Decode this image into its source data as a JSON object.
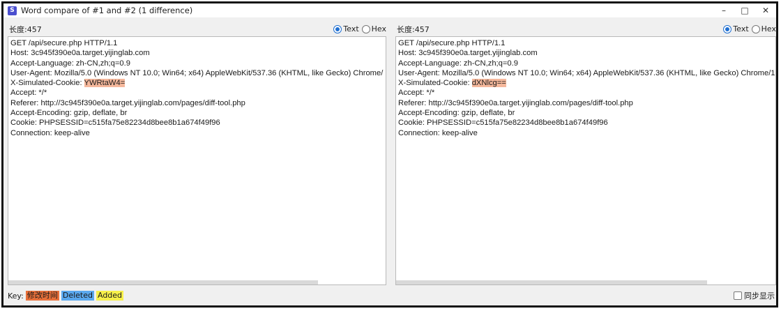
{
  "window": {
    "title": "Word compare of #1 and #2  (1 difference)",
    "icon_text": "S",
    "controls": {
      "minimize": "–",
      "maximize": "□",
      "close": "✕"
    }
  },
  "left_pane": {
    "length_label": "长度:457",
    "radio_text": "Text",
    "radio_hex": "Hex",
    "lines": [
      "GET /api/secure.php HTTP/1.1",
      "Host: 3c945f390e0a.target.yijinglab.com",
      "Accept-Language: zh-CN,zh;q=0.9",
      "User-Agent: Mozilla/5.0 (Windows NT 10.0; Win64; x64) AppleWebKit/537.36 (KHTML, like Gecko) Chrome/",
      "Accept: */*",
      "Referer: http://3c945f390e0a.target.yijinglab.com/pages/diff-tool.php",
      "Accept-Encoding: gzip, deflate, br",
      "Cookie: PHPSESSID=c515fa75e82234d8bee8b1a674f49f96",
      "Connection: keep-alive"
    ],
    "cookie_prefix": "X-Simulated-Cookie: ",
    "cookie_value": "YWRtaW4="
  },
  "right_pane": {
    "length_label": "长度:457",
    "radio_text": "Text",
    "radio_hex": "Hex",
    "lines": [
      "GET /api/secure.php HTTP/1.1",
      "Host: 3c945f390e0a.target.yijinglab.com",
      "Accept-Language: zh-CN,zh;q=0.9",
      "User-Agent: Mozilla/5.0 (Windows NT 10.0; Win64; x64) AppleWebKit/537.36 (KHTML, like Gecko) Chrome/1",
      "Accept: */*",
      "Referer: http://3c945f390e0a.target.yijinglab.com/pages/diff-tool.php",
      "Accept-Encoding: gzip, deflate, br",
      "Cookie: PHPSESSID=c515fa75e82234d8bee8b1a674f49f96",
      "Connection: keep-alive"
    ],
    "cookie_prefix": "X-Simulated-Cookie: ",
    "cookie_value": "dXNlcg=="
  },
  "footer": {
    "key_label": "Key:",
    "modified": "修改时间",
    "deleted": "Deleted",
    "added": "Added",
    "sync_label": "同步显示"
  },
  "colors": {
    "modified_key": "#e8703a",
    "modified_highlight": "#f5b89c",
    "deleted": "#5aa8ee",
    "added": "#f7f04a",
    "radio_accent": "#1f6fd1"
  }
}
